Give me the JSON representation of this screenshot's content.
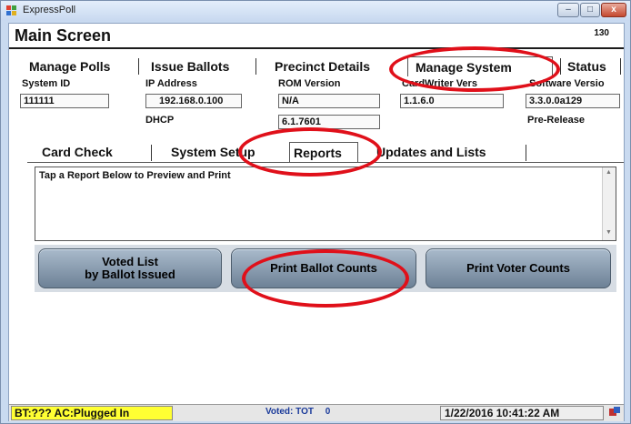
{
  "window": {
    "title": "ExpressPoll",
    "controls": [
      "–",
      "□",
      "x"
    ]
  },
  "screen": {
    "title": "Main Screen",
    "number": "130"
  },
  "main_tabs": [
    {
      "label": "Manage Polls"
    },
    {
      "label": "Issue Ballots"
    },
    {
      "label": "Precinct Details"
    },
    {
      "label": "Manage System"
    },
    {
      "label": "Status"
    }
  ],
  "fields": {
    "system_id": {
      "label": "System ID",
      "value": "111111"
    },
    "ip_address": {
      "label": "IP Address",
      "value": "192.168.0.100",
      "sub_label": "DHCP"
    },
    "rom_version": {
      "label": "ROM Version",
      "value": "N/A",
      "value2": "6.1.7601"
    },
    "cardwriter": {
      "label": "CardWriter Vers",
      "value": "1.1.6.0"
    },
    "software": {
      "label": "Software Versio",
      "value": "3.3.0.0a129",
      "sub_label": "Pre-Release"
    }
  },
  "sub_tabs": [
    {
      "label": "Card Check"
    },
    {
      "label": "System Setup"
    },
    {
      "label": "Reports"
    },
    {
      "label": "Updates and Lists"
    }
  ],
  "report_area": {
    "text": "Tap a Report Below to Preview and Print"
  },
  "buttons": {
    "voted_list_line1": "Voted List",
    "voted_list_line2": "by Ballot Issued",
    "print_ballot_counts": "Print Ballot Counts",
    "print_voter_counts": "Print Voter Counts"
  },
  "status": {
    "battery": "BT:??? AC:Plugged In",
    "voted_label": "Voted:  TOT",
    "voted_count": "0",
    "datetime": "1/22/2016 10:41:22 AM"
  },
  "colors": {
    "highlight_oval": "#e0101a",
    "battery_bg": "#ffff33",
    "voted_text": "#1a3a9a"
  }
}
